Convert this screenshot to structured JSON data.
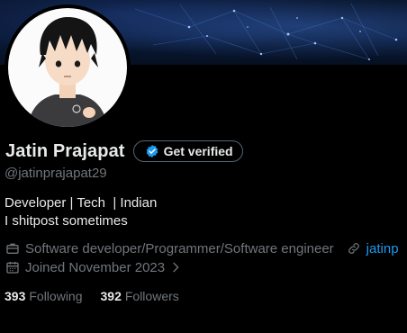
{
  "profile": {
    "display_name": "Jatin Prajapat",
    "verify_label": "Get verified",
    "handle": "@jatinprajapat29",
    "bio_line1": "Developer | Tech  | Indian",
    "bio_line2": "I shitpost sometimes",
    "profession": "Software developer/Programmer/Software engineer",
    "website": "jatinp",
    "joined": "Joined November 2023",
    "following_count": "393",
    "following_label": "Following",
    "followers_count": "392",
    "followers_label": "Followers"
  },
  "colors": {
    "background": "#000000",
    "text_primary": "#e7e9ea",
    "text_secondary": "#71767b",
    "link": "#1d9bf0",
    "verified_badge": "#1d9bf0",
    "button_border": "#536471"
  },
  "icons": {
    "verify": "verified-badge-icon",
    "profession": "briefcase-icon",
    "website": "link-icon",
    "joined": "calendar-icon",
    "joined_more": "chevron-right-icon"
  }
}
